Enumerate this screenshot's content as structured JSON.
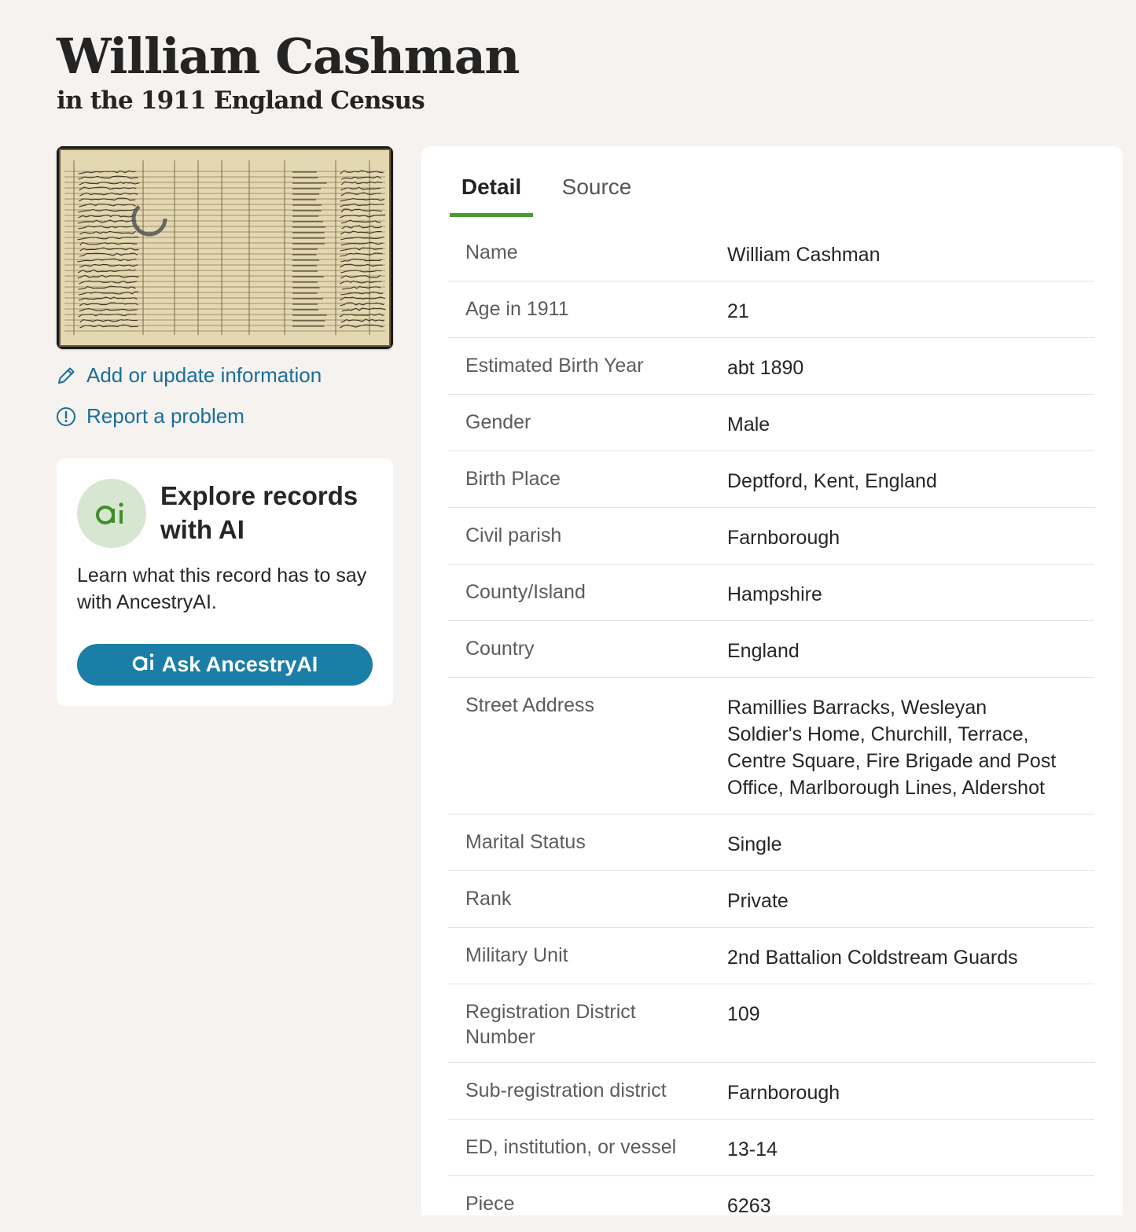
{
  "header": {
    "title": "William Cashman",
    "subtitle": "in the 1911 England Census"
  },
  "sidebar": {
    "record_image_alt": "Census record image",
    "add_link": "Add or update information",
    "report_link": "Report a problem",
    "ai_card": {
      "avatar_text": "ai",
      "title": "Explore records with AI",
      "description": "Learn what this record has to say with AncestryAI.",
      "button_label": "Ask AncestryAI"
    }
  },
  "tabs": [
    {
      "label": "Detail",
      "active": true
    },
    {
      "label": "Source",
      "active": false
    }
  ],
  "details": [
    {
      "label": "Name",
      "value": "William Cashman"
    },
    {
      "label": "Age in 1911",
      "value": "21"
    },
    {
      "label": "Estimated Birth Year",
      "value": "abt 1890"
    },
    {
      "label": "Gender",
      "value": "Male"
    },
    {
      "label": "Birth Place",
      "value": "Deptford, Kent, England"
    },
    {
      "label": "Civil parish",
      "value": "Farnborough"
    },
    {
      "label": "County/Island",
      "value": "Hampshire"
    },
    {
      "label": "Country",
      "value": "England"
    },
    {
      "label": "Street Address",
      "value": "Ramillies Barracks, Wesleyan Soldier's Home, Churchill, Terrace, Centre Square, Fire Brigade and Post Office, Marlborough Lines, Aldershot"
    },
    {
      "label": "Marital Status",
      "value": "Single"
    },
    {
      "label": "Rank",
      "value": "Private"
    },
    {
      "label": "Military Unit",
      "value": "2nd Battalion Coldstream Guards"
    },
    {
      "label": "Registration District Number",
      "value": "109"
    },
    {
      "label": "Sub-registration district",
      "value": "Farnborough"
    },
    {
      "label": "ED, institution, or vessel",
      "value": "13-14"
    },
    {
      "label": "Piece",
      "value": "6263"
    }
  ],
  "colors": {
    "link": "#1a6f9a",
    "button": "#1a7ea7",
    "tab_underline": "#4d9a2e",
    "ai_avatar_bg": "#d7e6d1",
    "ai_logo": "#3f8f2a"
  }
}
